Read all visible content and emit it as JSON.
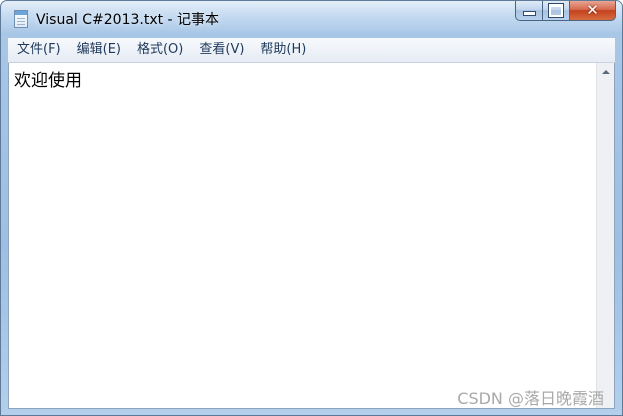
{
  "window": {
    "title": "Visual C#2013.txt - 记事本"
  },
  "menu": {
    "items": [
      {
        "label": "文件(F)"
      },
      {
        "label": "编辑(E)"
      },
      {
        "label": "格式(O)"
      },
      {
        "label": "查看(V)"
      },
      {
        "label": "帮助(H)"
      }
    ]
  },
  "editor": {
    "content": "欢迎使用"
  },
  "watermark": "CSDN @落日晚霞酒",
  "icons": {
    "app": "notepad-icon",
    "minimize": "minimize-icon",
    "maximize": "maximize-icon",
    "close": "close-icon",
    "scroll_up": "scroll-up-arrow-icon"
  },
  "colors": {
    "menu_text": "#1e395b",
    "close_button": "#c4421f",
    "frame": "#9ebfe3"
  }
}
